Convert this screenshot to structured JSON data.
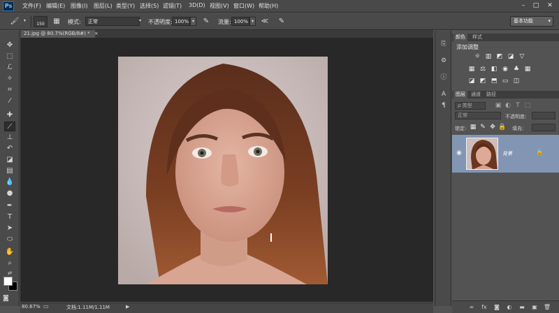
{
  "app": {
    "logo": "Ps"
  },
  "menu": [
    {
      "label": "文件(F)"
    },
    {
      "label": "编辑(E)"
    },
    {
      "label": "图像(I)"
    },
    {
      "label": "图层(L)"
    },
    {
      "label": "类型(Y)"
    },
    {
      "label": "选择(S)"
    },
    {
      "label": "滤镜(T)"
    },
    {
      "label": "3D(D)"
    },
    {
      "label": "视图(V)"
    },
    {
      "label": "窗口(W)"
    },
    {
      "label": "帮助(H)"
    }
  ],
  "window_controls": {
    "minimize": "–",
    "maximize": "□",
    "close": "✕"
  },
  "options_bar": {
    "brush_size": "150",
    "mode_label": "模式:",
    "mode_value": "正常",
    "opacity_label": "不透明度:",
    "opacity_value": "100%",
    "flow_label": "流量:",
    "flow_value": "100%",
    "workspace": "基本功能"
  },
  "document": {
    "tab_title": "21.jpg @ 80.7%(RGB/8#) *",
    "zoom": "80.67%",
    "doc_info": "文档:1.11M/1.11M"
  },
  "panels": {
    "top_tabs": [
      "颜色",
      "样式"
    ],
    "adjustments_title": "添加调整",
    "layer_tabs": [
      "图层",
      "通道",
      "路径"
    ],
    "filter_kind": "ρ 类型",
    "blend_mode": "正常",
    "opacity_label": "不透明度:",
    "lock_label": "锁定:",
    "fill_label": "填充:",
    "layer_name": "背景"
  },
  "colors": {
    "foreground": "#ffffff",
    "background": "#000000",
    "selected_layer": "#8296b3"
  }
}
